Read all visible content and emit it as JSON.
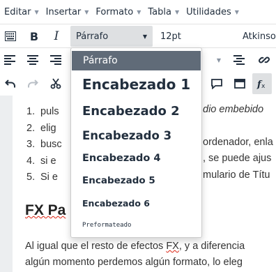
{
  "menubar": {
    "items": [
      "Editar",
      "Insertar",
      "Formato",
      "Tabla",
      "Utilidades"
    ]
  },
  "toolbar": {
    "block_format_value": "Párrafo",
    "font_size_value": "12pt",
    "font_family_value": "Atkinso",
    "bold_label": "B",
    "italic_label": "I"
  },
  "block_formats": {
    "options": [
      "Párrafo",
      "Encabezado 1",
      "Encabezado 2",
      "Encabezado 3",
      "Encabezado 4",
      "Encabezado 5",
      "Encabezado 6",
      "Preformateado"
    ],
    "selected_index": 0
  },
  "content": {
    "list": [
      {
        "num": "1.",
        "text": "puls",
        "tail": "dio embebido"
      },
      {
        "num": "2.",
        "text": "elig",
        "tail": ""
      },
      {
        "num": "3.",
        "text": "busc",
        "tail": "ordenador, enla"
      },
      {
        "num": "4.",
        "text": "si e",
        "tail": ", se puede ajus"
      },
      {
        "num": "5.",
        "text": "Si e",
        "tail": "mulario de Títu"
      }
    ],
    "heading_visible": "FX Pa",
    "paragraph_line1_before": "Al igual que el resto de efectos ",
    "paragraph_line1_fx": "FX",
    "paragraph_line1_after": ", y a diferencia",
    "paragraph_line2": "algún momento perdemos algún formato, lo eleg"
  },
  "colors": {
    "selected_bg": "#606b78",
    "active_select_bg": "#dee0e2",
    "spell_underline": "#dd1111"
  }
}
